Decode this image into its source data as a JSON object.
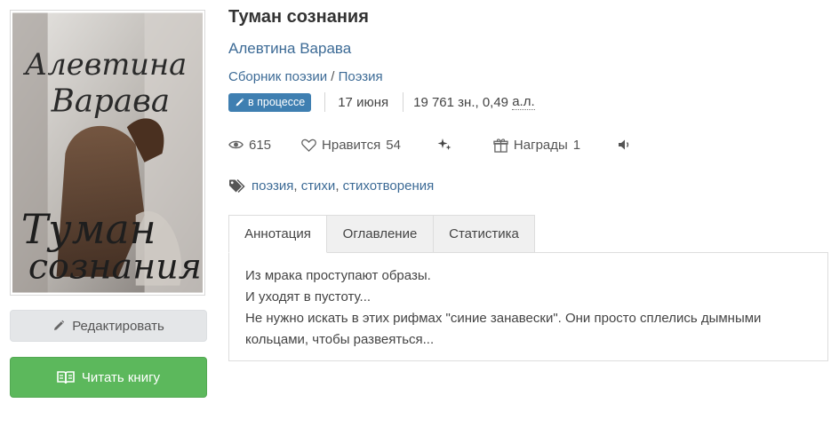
{
  "book": {
    "title": "Туман сознания",
    "author": "Алевтина Варава",
    "genres": [
      "Сборник поэзии",
      "Поэзия"
    ],
    "genre_separator": " / ",
    "status_badge": "в процессе",
    "date": "17 июня",
    "size_chars": "19 761 зн., 0,49",
    "size_unit": "а.л."
  },
  "cover": {
    "author_text_line1": "Алевтина",
    "author_text_line2": "Варава",
    "title_text_line1": "Туман",
    "title_text_line2": "сознания"
  },
  "stats": {
    "views": "615",
    "likes_label": "Нравится",
    "likes_count": "54",
    "awards_label": "Награды",
    "awards_count": "1"
  },
  "tags": [
    "поэзия",
    "стихи",
    "стихотворения"
  ],
  "tabs": [
    "Аннотация",
    "Оглавление",
    "Статистика"
  ],
  "annotation": [
    "Из мрака проступают образы.",
    "И уходят в пустоту...",
    "Не нужно искать в этих рифмах \"синие занавески\". Они просто сплелись дымными",
    "кольцами, чтобы развеяться..."
  ],
  "buttons": {
    "edit": "Редактировать",
    "read": "Читать книгу"
  },
  "colors": {
    "link": "#3d6b96",
    "badge": "#3f7fb1",
    "read_button": "#5cb85c",
    "edit_button": "#e4e6e8"
  }
}
